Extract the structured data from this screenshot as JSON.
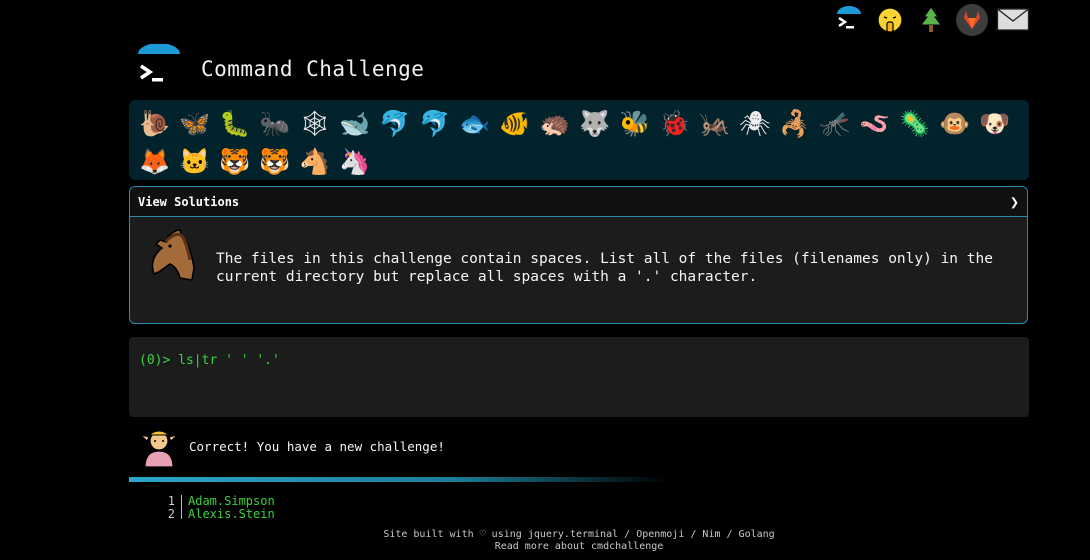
{
  "top_icons": [
    {
      "name": "cmd-logo-icon",
      "glyph": ""
    },
    {
      "name": "shush-face-icon",
      "glyph": "🤫"
    },
    {
      "name": "tree-icon",
      "glyph": "🌲"
    },
    {
      "name": "gitlab-icon",
      "glyph": ""
    },
    {
      "name": "mail-icon",
      "glyph": "✉"
    }
  ],
  "header": {
    "title": "Command Challenge"
  },
  "animals": [
    "🐌",
    "🦋",
    "🐛",
    "🐜",
    "🕸",
    "🐋",
    "🐬",
    "🐬",
    "🐟",
    "🐠",
    "🦔",
    "🐺",
    "🐝",
    "🐞",
    "🦗",
    "🕷",
    "🦂",
    "🦟",
    "🪱",
    "🦠",
    "🐵",
    "🐶",
    "🦊",
    "🐱",
    "🐯",
    "🐯",
    "🐴",
    "🦄"
  ],
  "panel": {
    "view_solutions": "View Solutions",
    "chevron": "❯",
    "horse": "🐴",
    "challenge": "The files in this challenge contain spaces. List all of the files (filenames only) in the current directory but replace all spaces with a '.' character."
  },
  "terminal": {
    "prompt_prefix": "(0)> ",
    "command": "ls|tr ' ' '.'"
  },
  "result": {
    "avatar": "🧝",
    "message": "Correct! You have a new challenge!"
  },
  "output": [
    {
      "num": "1",
      "name": "Adam.Simpson"
    },
    {
      "num": "2",
      "name": "Alexis.Stein"
    }
  ],
  "footer": {
    "line1_pre": "Site built with ♡ using ",
    "link1": "jquery.terminal",
    "sep1": " / ",
    "link2": "Openmoji",
    "sep2": " / ",
    "link3": "Nim",
    "sep3": " / ",
    "link4": "Golang",
    "line2": "Read more about cmdchallenge"
  },
  "colors": {
    "accent": "#2c8aa8",
    "terminal_green": "#3dd23d",
    "strip_bg": "#02222c"
  }
}
